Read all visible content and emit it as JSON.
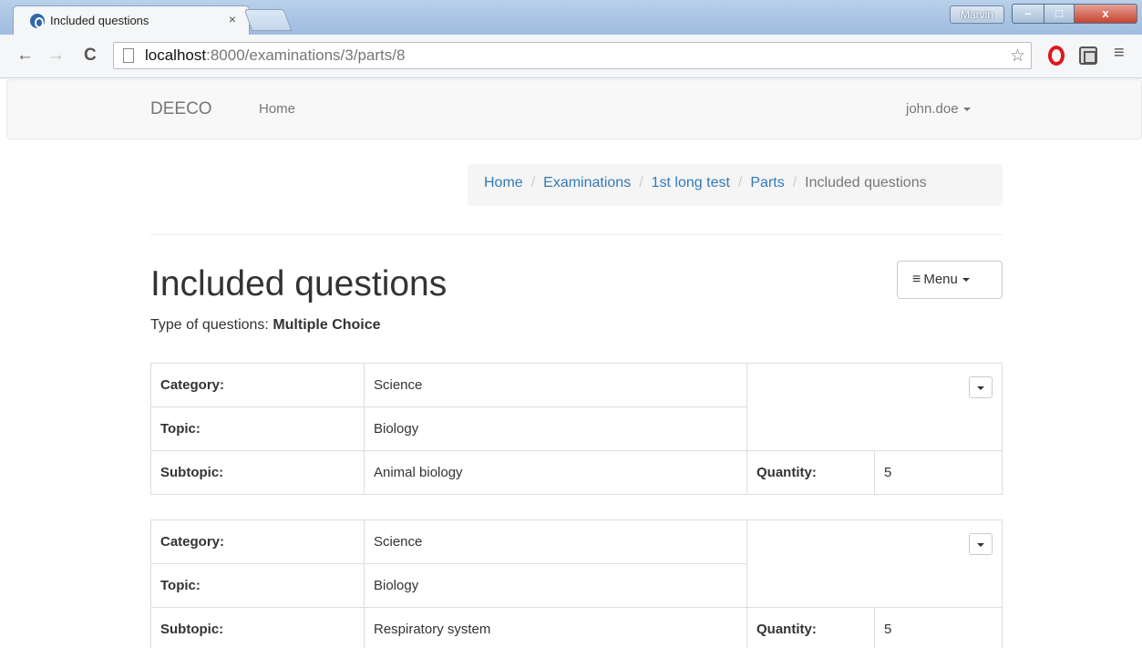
{
  "browser": {
    "tab_title": "Included questions",
    "tab_close": "×",
    "user_badge": "Marvin",
    "win_min": "–",
    "win_max": "□",
    "win_close": "x",
    "back": "←",
    "forward": "→",
    "reload": "C",
    "url_host": "localhost",
    "url_path": ":8000/examinations/3/parts/8",
    "star": "☆",
    "menu": "≡"
  },
  "navbar": {
    "brand": "DEECO",
    "home": "Home",
    "user": "john.doe"
  },
  "breadcrumb": {
    "items": [
      "Home",
      "Examinations",
      "1st long test",
      "Parts"
    ],
    "separator": "/",
    "active": "Included questions"
  },
  "page": {
    "title": "Included questions",
    "subtitle_label": "Type of questions: ",
    "subtitle_value": "Multiple Choice",
    "menu_label": "Menu",
    "menu_icon": "≡"
  },
  "question_sets": [
    {
      "category_label": "Category:",
      "category": "Science",
      "topic_label": "Topic:",
      "topic": "Biology",
      "subtopic_label": "Subtopic:",
      "subtopic": "Animal biology",
      "quantity_label": "Quantity:",
      "quantity": "5"
    },
    {
      "category_label": "Category:",
      "category": "Science",
      "topic_label": "Topic:",
      "topic": "Biology",
      "subtopic_label": "Subtopic:",
      "subtopic": "Respiratory system",
      "quantity_label": "Quantity:",
      "quantity": "5"
    }
  ]
}
